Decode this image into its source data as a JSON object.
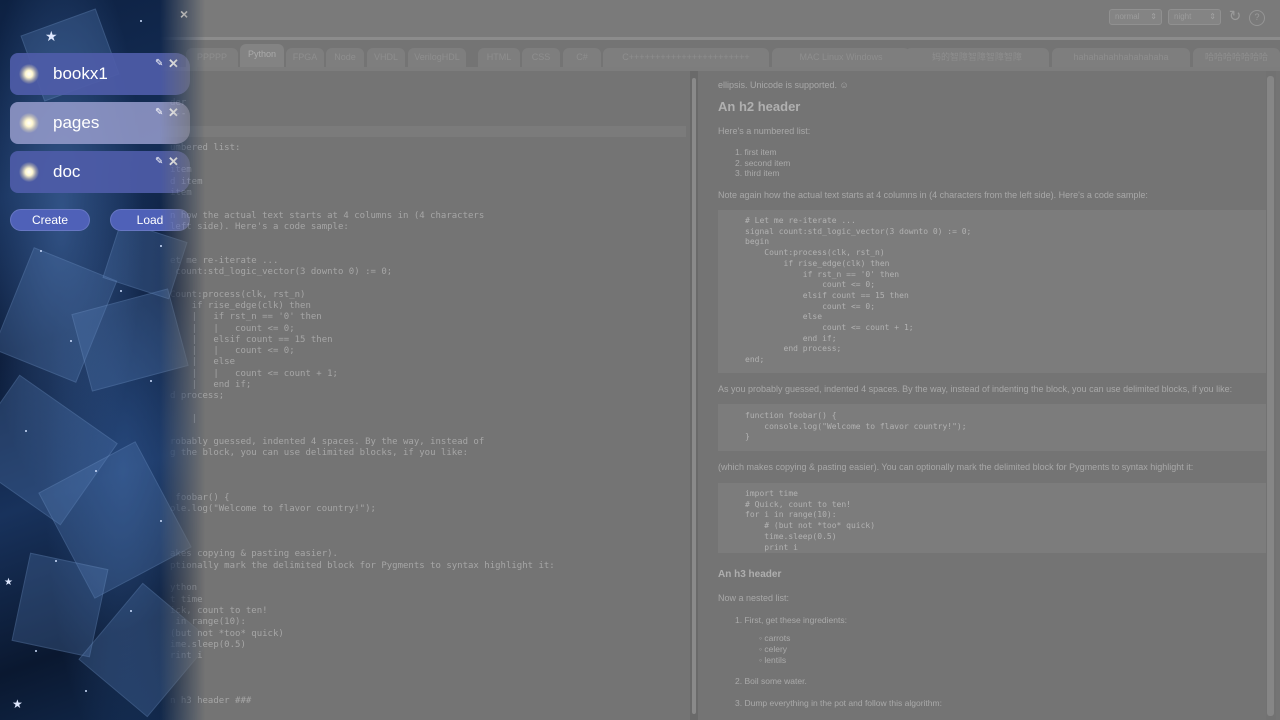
{
  "toolbar": {
    "mode_select": "normal",
    "theme_select": "night",
    "refresh_icon": "↻",
    "help_icon": "?"
  },
  "tabs": [
    {
      "label": "PPPPP",
      "active": false
    },
    {
      "label": "Python",
      "active": true
    },
    {
      "label": "FPGA",
      "active": false
    },
    {
      "label": "Node",
      "active": false
    },
    {
      "label": "VHDL",
      "active": false
    },
    {
      "label": "VerilogHDL",
      "active": false
    },
    {
      "label": "HTML",
      "active": false
    },
    {
      "label": "CSS",
      "active": false
    },
    {
      "label": "C#",
      "active": false
    },
    {
      "label": "C+++++++++++++++++++++++",
      "active": false
    },
    {
      "label": "MAC Linux Windows",
      "active": false
    },
    {
      "label": "妈的智障智障智障智障",
      "active": false
    },
    {
      "label": "hahahahahhahahahaha",
      "active": false
    },
    {
      "label": "哈哈哈哈哈哈哈",
      "active": false
    }
  ],
  "editor": {
    "lines": [
      "",
      "",
      "der",
      "---",
      "",
      "",
      "umbered list:",
      "",
      "item",
      "d item",
      "item",
      "",
      "n how the actual text starts at 4 columns in (4 characters",
      "left side). Here's a code sample:",
      "",
      "",
      "et me re-iterate ...",
      " count:std_logic_vector(3 downto 0) := 0;",
      "",
      "Count:process(clk, rst_n)",
      "    if rise_edge(clk) then",
      "    |   if rst_n == '0' then",
      "    |   |   count <= 0;",
      "    |   elsif count == 15 then",
      "    |   |   count <= 0;",
      "    |   else",
      "    |   |   count <= count + 1;",
      "    |   end if;",
      "d process;",
      "",
      "    |",
      "",
      "robably guessed, indented 4 spaces. By the way, instead of",
      "g the block, you can use delimited blocks, if you like:",
      "",
      "",
      "",
      " foobar() {",
      "ole.log(\"Welcome to flavor country!\");",
      "",
      "",
      "",
      "akes copying & pasting easier).",
      "ptionally mark the delimited block for Pygments to syntax highlight it:",
      "",
      "ython",
      "t time",
      "ick, count to ten!",
      " in range(10):",
      "(but not *too* quick)",
      "ime.sleep(0.5)",
      "rint i",
      "",
      "",
      "",
      "n h3 header ###"
    ]
  },
  "preview": {
    "intro": "ellipsis. Unicode is supported. ☺",
    "h2": "An h2 header",
    "numbered_intro": "Here's a numbered list:",
    "numbered": [
      "first item",
      "second item",
      "third item"
    ],
    "note": "Note again how the actual text starts at 4 columns in (4 characters from the left side). Here's a code sample:",
    "code1": [
      "# Let me re-iterate ...",
      "signal count:std_logic_vector(3 downto 0) := 0;",
      "begin",
      "    Count:process(clk, rst_n)",
      "        if rise_edge(clk) then",
      "            if rst_n == '0' then",
      "                count <= 0;",
      "            elsif count == 15 then",
      "                count <= 0;",
      "            else",
      "                count <= count + 1;",
      "            end if;",
      "        end process;",
      "end;"
    ],
    "guess": "As you probably guessed, indented 4 spaces. By the way, instead of indenting the block, you can use delimited blocks, if you like:",
    "code2": [
      "function foobar() {",
      "    console.log(\"Welcome to flavor country!\");",
      "}"
    ],
    "copying": "(which makes copying & pasting easier). You can optionally mark the delimited block for Pygments to syntax highlight it:",
    "code3": [
      "import time",
      "# Quick, count to ten!",
      "for i in range(10):",
      "    # (but not *too* quick)",
      "    time.sleep(0.5)",
      "    print i"
    ],
    "h3": "An h3 header",
    "nested_intro": "Now a nested list:",
    "nested1": "First, get these ingredients:",
    "ingredients": [
      "carrots",
      "celery",
      "lentils"
    ],
    "nested2": "Boil some water.",
    "nested3": "Dump everything in the pot and follow this algorithm:"
  },
  "sidepanel": {
    "close_icon": "×",
    "books": [
      {
        "name": "bookx1",
        "selected": false
      },
      {
        "name": "pages",
        "selected": true
      },
      {
        "name": "doc",
        "selected": false
      }
    ],
    "edit_icon": "✎",
    "delete_icon": "✕",
    "create_label": "Create",
    "load_label": "Load"
  }
}
